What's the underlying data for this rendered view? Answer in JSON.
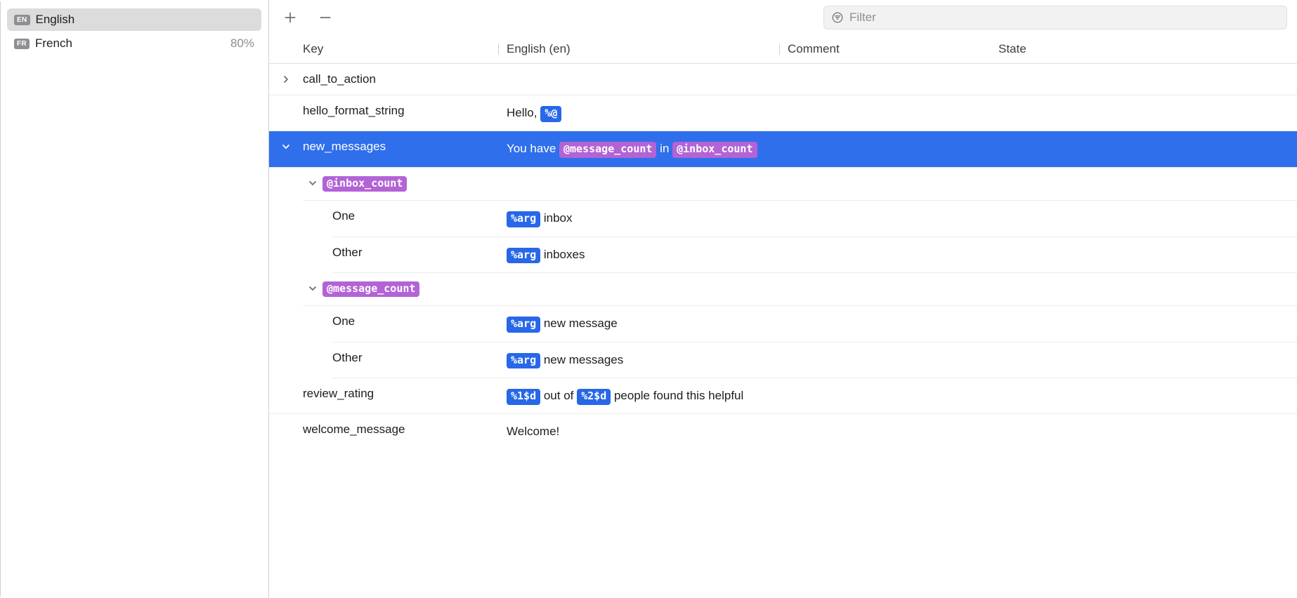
{
  "sidebar": {
    "languages": [
      {
        "badge": "EN",
        "name": "English",
        "progress": ""
      },
      {
        "badge": "FR",
        "name": "French",
        "progress": "80%"
      }
    ]
  },
  "toolbar": {
    "filter_placeholder": "Filter"
  },
  "columns": {
    "key": "Key",
    "english": "English (en)",
    "comment": "Comment",
    "state": "State"
  },
  "rows": {
    "call_to_action_key": "call_to_action",
    "hello_key": "hello_format_string",
    "hello_pre": "Hello, ",
    "hello_token": "%@",
    "new_messages_key": "new_messages",
    "nm_pre": "You have ",
    "nm_token1": "@message_count",
    "nm_mid": " in ",
    "nm_token2": "@inbox_count",
    "inbox_count_badge": "@inbox_count",
    "inbox_one_key": "One",
    "inbox_one_token": "%arg",
    "inbox_one_post": " inbox",
    "inbox_other_key": "Other",
    "inbox_other_token": "%arg",
    "inbox_other_post": " inboxes",
    "message_count_badge": "@message_count",
    "msg_one_key": "One",
    "msg_one_token": "%arg",
    "msg_one_post": " new message",
    "msg_other_key": "Other",
    "msg_other_token": "%arg",
    "msg_other_post": " new messages",
    "review_key": "review_rating",
    "review_t1": "%1$d",
    "review_mid1": " out of ",
    "review_t2": "%2$d",
    "review_post": " people found this helpful",
    "welcome_key": "welcome_message",
    "welcome_val": "Welcome!"
  }
}
